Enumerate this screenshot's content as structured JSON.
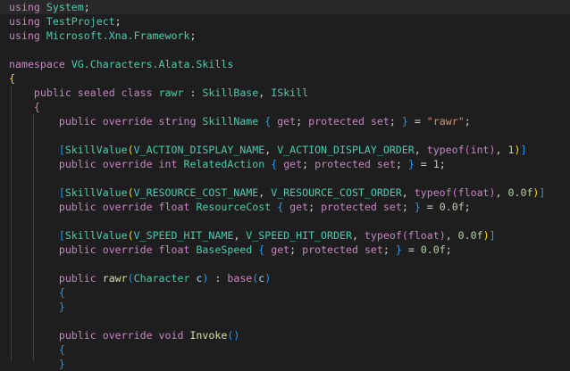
{
  "colors": {
    "background": "#1e1e1e",
    "active_line": "#282828",
    "keyword": "#c586c0",
    "type": "#4ec9b0",
    "function": "#dcdcaa",
    "string": "#ce9178",
    "number": "#b5cea8",
    "parameter": "#9cdcfe",
    "text": "#d4d4d4",
    "bracket_1": "#ffd700",
    "bracket_2": "#da70d6",
    "bracket_3": "#179fff"
  },
  "lines": [
    [
      [
        "kw",
        "using"
      ],
      [
        "pn",
        " "
      ],
      [
        "ty",
        "System"
      ],
      [
        "pn",
        ";"
      ]
    ],
    [
      [
        "kw",
        "using"
      ],
      [
        "pn",
        " "
      ],
      [
        "ty",
        "TestProject"
      ],
      [
        "pn",
        ";"
      ]
    ],
    [
      [
        "kw",
        "using"
      ],
      [
        "pn",
        " "
      ],
      [
        "ty",
        "Microsoft.Xna.Framework"
      ],
      [
        "pn",
        ";"
      ]
    ],
    [],
    [
      [
        "kw",
        "namespace"
      ],
      [
        "pn",
        " "
      ],
      [
        "ty",
        "VG.Characters.Alata.Skills"
      ]
    ],
    [
      [
        "b1",
        "{"
      ]
    ],
    [
      [
        "pn",
        "    "
      ],
      [
        "kw",
        "public"
      ],
      [
        "pn",
        " "
      ],
      [
        "kw",
        "sealed"
      ],
      [
        "pn",
        " "
      ],
      [
        "kw",
        "class"
      ],
      [
        "pn",
        " "
      ],
      [
        "ty",
        "rawr"
      ],
      [
        "pn",
        " : "
      ],
      [
        "ty",
        "SkillBase"
      ],
      [
        "pn",
        ", "
      ],
      [
        "ty",
        "ISkill"
      ]
    ],
    [
      [
        "pn",
        "    "
      ],
      [
        "b2",
        "{"
      ]
    ],
    [
      [
        "pn",
        "        "
      ],
      [
        "kw",
        "public"
      ],
      [
        "pn",
        " "
      ],
      [
        "kw",
        "override"
      ],
      [
        "pn",
        " "
      ],
      [
        "kw",
        "string"
      ],
      [
        "pn",
        " "
      ],
      [
        "ty",
        "SkillName"
      ],
      [
        "pn",
        " "
      ],
      [
        "b3",
        "{"
      ],
      [
        "pn",
        " "
      ],
      [
        "kw",
        "get"
      ],
      [
        "pn",
        "; "
      ],
      [
        "kw",
        "protected"
      ],
      [
        "pn",
        " "
      ],
      [
        "kw",
        "set"
      ],
      [
        "pn",
        "; "
      ],
      [
        "b3",
        "}"
      ],
      [
        "pn",
        " = "
      ],
      [
        "str",
        "\"rawr\""
      ],
      [
        "pn",
        ";"
      ]
    ],
    [],
    [
      [
        "pn",
        "        "
      ],
      [
        "b3",
        "["
      ],
      [
        "ty",
        "SkillValue"
      ],
      [
        "b1",
        "("
      ],
      [
        "ty",
        "V_ACTION_DISPLAY_NAME"
      ],
      [
        "pn",
        ", "
      ],
      [
        "ty",
        "V_ACTION_DISPLAY_ORDER"
      ],
      [
        "pn",
        ", "
      ],
      [
        "kw",
        "typeof"
      ],
      [
        "b2",
        "("
      ],
      [
        "kw",
        "int"
      ],
      [
        "b2",
        ")"
      ],
      [
        "pn",
        ", "
      ],
      [
        "num",
        "1"
      ],
      [
        "b1",
        ")"
      ],
      [
        "b3",
        "]"
      ]
    ],
    [
      [
        "pn",
        "        "
      ],
      [
        "kw",
        "public"
      ],
      [
        "pn",
        " "
      ],
      [
        "kw",
        "override"
      ],
      [
        "pn",
        " "
      ],
      [
        "kw",
        "int"
      ],
      [
        "pn",
        " "
      ],
      [
        "ty",
        "RelatedAction"
      ],
      [
        "pn",
        " "
      ],
      [
        "b3",
        "{"
      ],
      [
        "pn",
        " "
      ],
      [
        "kw",
        "get"
      ],
      [
        "pn",
        "; "
      ],
      [
        "kw",
        "protected"
      ],
      [
        "pn",
        " "
      ],
      [
        "kw",
        "set"
      ],
      [
        "pn",
        "; "
      ],
      [
        "b3",
        "}"
      ],
      [
        "pn",
        " = "
      ],
      [
        "num",
        "1"
      ],
      [
        "pn",
        ";"
      ]
    ],
    [],
    [
      [
        "pn",
        "        "
      ],
      [
        "b3",
        "["
      ],
      [
        "ty",
        "SkillValue"
      ],
      [
        "b1",
        "("
      ],
      [
        "ty",
        "V_RESOURCE_COST_NAME"
      ],
      [
        "pn",
        ", "
      ],
      [
        "ty",
        "V_RESOURCE_COST_ORDER"
      ],
      [
        "pn",
        ", "
      ],
      [
        "kw",
        "typeof"
      ],
      [
        "b2",
        "("
      ],
      [
        "kw",
        "float"
      ],
      [
        "b2",
        ")"
      ],
      [
        "pn",
        ", "
      ],
      [
        "num",
        "0.0f"
      ],
      [
        "b1",
        ")"
      ],
      [
        "b3",
        "]"
      ]
    ],
    [
      [
        "pn",
        "        "
      ],
      [
        "kw",
        "public"
      ],
      [
        "pn",
        " "
      ],
      [
        "kw",
        "override"
      ],
      [
        "pn",
        " "
      ],
      [
        "kw",
        "float"
      ],
      [
        "pn",
        " "
      ],
      [
        "ty",
        "ResourceCost"
      ],
      [
        "pn",
        " "
      ],
      [
        "b3",
        "{"
      ],
      [
        "pn",
        " "
      ],
      [
        "kw",
        "get"
      ],
      [
        "pn",
        "; "
      ],
      [
        "kw",
        "protected"
      ],
      [
        "pn",
        " "
      ],
      [
        "kw",
        "set"
      ],
      [
        "pn",
        "; "
      ],
      [
        "b3",
        "}"
      ],
      [
        "pn",
        " = "
      ],
      [
        "num",
        "0.0f"
      ],
      [
        "pn",
        ";"
      ]
    ],
    [],
    [
      [
        "pn",
        "        "
      ],
      [
        "b3",
        "["
      ],
      [
        "ty",
        "SkillValue"
      ],
      [
        "b1",
        "("
      ],
      [
        "ty",
        "V_SPEED_HIT_NAME"
      ],
      [
        "pn",
        ", "
      ],
      [
        "ty",
        "V_SPEED_HIT_ORDER"
      ],
      [
        "pn",
        ", "
      ],
      [
        "kw",
        "typeof"
      ],
      [
        "b2",
        "("
      ],
      [
        "kw",
        "float"
      ],
      [
        "b2",
        ")"
      ],
      [
        "pn",
        ", "
      ],
      [
        "num",
        "0.0f"
      ],
      [
        "b1",
        ")"
      ],
      [
        "b3",
        "]"
      ]
    ],
    [
      [
        "pn",
        "        "
      ],
      [
        "kw",
        "public"
      ],
      [
        "pn",
        " "
      ],
      [
        "kw",
        "override"
      ],
      [
        "pn",
        " "
      ],
      [
        "kw",
        "float"
      ],
      [
        "pn",
        " "
      ],
      [
        "ty",
        "BaseSpeed"
      ],
      [
        "pn",
        " "
      ],
      [
        "b3",
        "{"
      ],
      [
        "pn",
        " "
      ],
      [
        "kw",
        "get"
      ],
      [
        "pn",
        "; "
      ],
      [
        "kw",
        "protected"
      ],
      [
        "pn",
        " "
      ],
      [
        "kw",
        "set"
      ],
      [
        "pn",
        "; "
      ],
      [
        "b3",
        "}"
      ],
      [
        "pn",
        " = "
      ],
      [
        "num",
        "0.0f"
      ],
      [
        "pn",
        ";"
      ]
    ],
    [],
    [
      [
        "pn",
        "        "
      ],
      [
        "kw",
        "public"
      ],
      [
        "pn",
        " "
      ],
      [
        "fn",
        "rawr"
      ],
      [
        "b3",
        "("
      ],
      [
        "ty",
        "Character"
      ],
      [
        "pn",
        " "
      ],
      [
        "prm",
        "c"
      ],
      [
        "b3",
        ")"
      ],
      [
        "pn",
        " : "
      ],
      [
        "kw",
        "base"
      ],
      [
        "b3",
        "("
      ],
      [
        "prm",
        "c"
      ],
      [
        "b3",
        ")"
      ]
    ],
    [
      [
        "pn",
        "        "
      ],
      [
        "b3",
        "{"
      ]
    ],
    [
      [
        "pn",
        "        "
      ],
      [
        "b3",
        "}"
      ]
    ],
    [],
    [
      [
        "pn",
        "        "
      ],
      [
        "kw",
        "public"
      ],
      [
        "pn",
        " "
      ],
      [
        "kw",
        "override"
      ],
      [
        "pn",
        " "
      ],
      [
        "kw",
        "void"
      ],
      [
        "pn",
        " "
      ],
      [
        "fn",
        "Invoke"
      ],
      [
        "b3",
        "()"
      ]
    ],
    [
      [
        "pn",
        "        "
      ],
      [
        "b3",
        "{"
      ]
    ],
    [
      [
        "pn",
        "        "
      ],
      [
        "b3",
        "}"
      ]
    ]
  ]
}
